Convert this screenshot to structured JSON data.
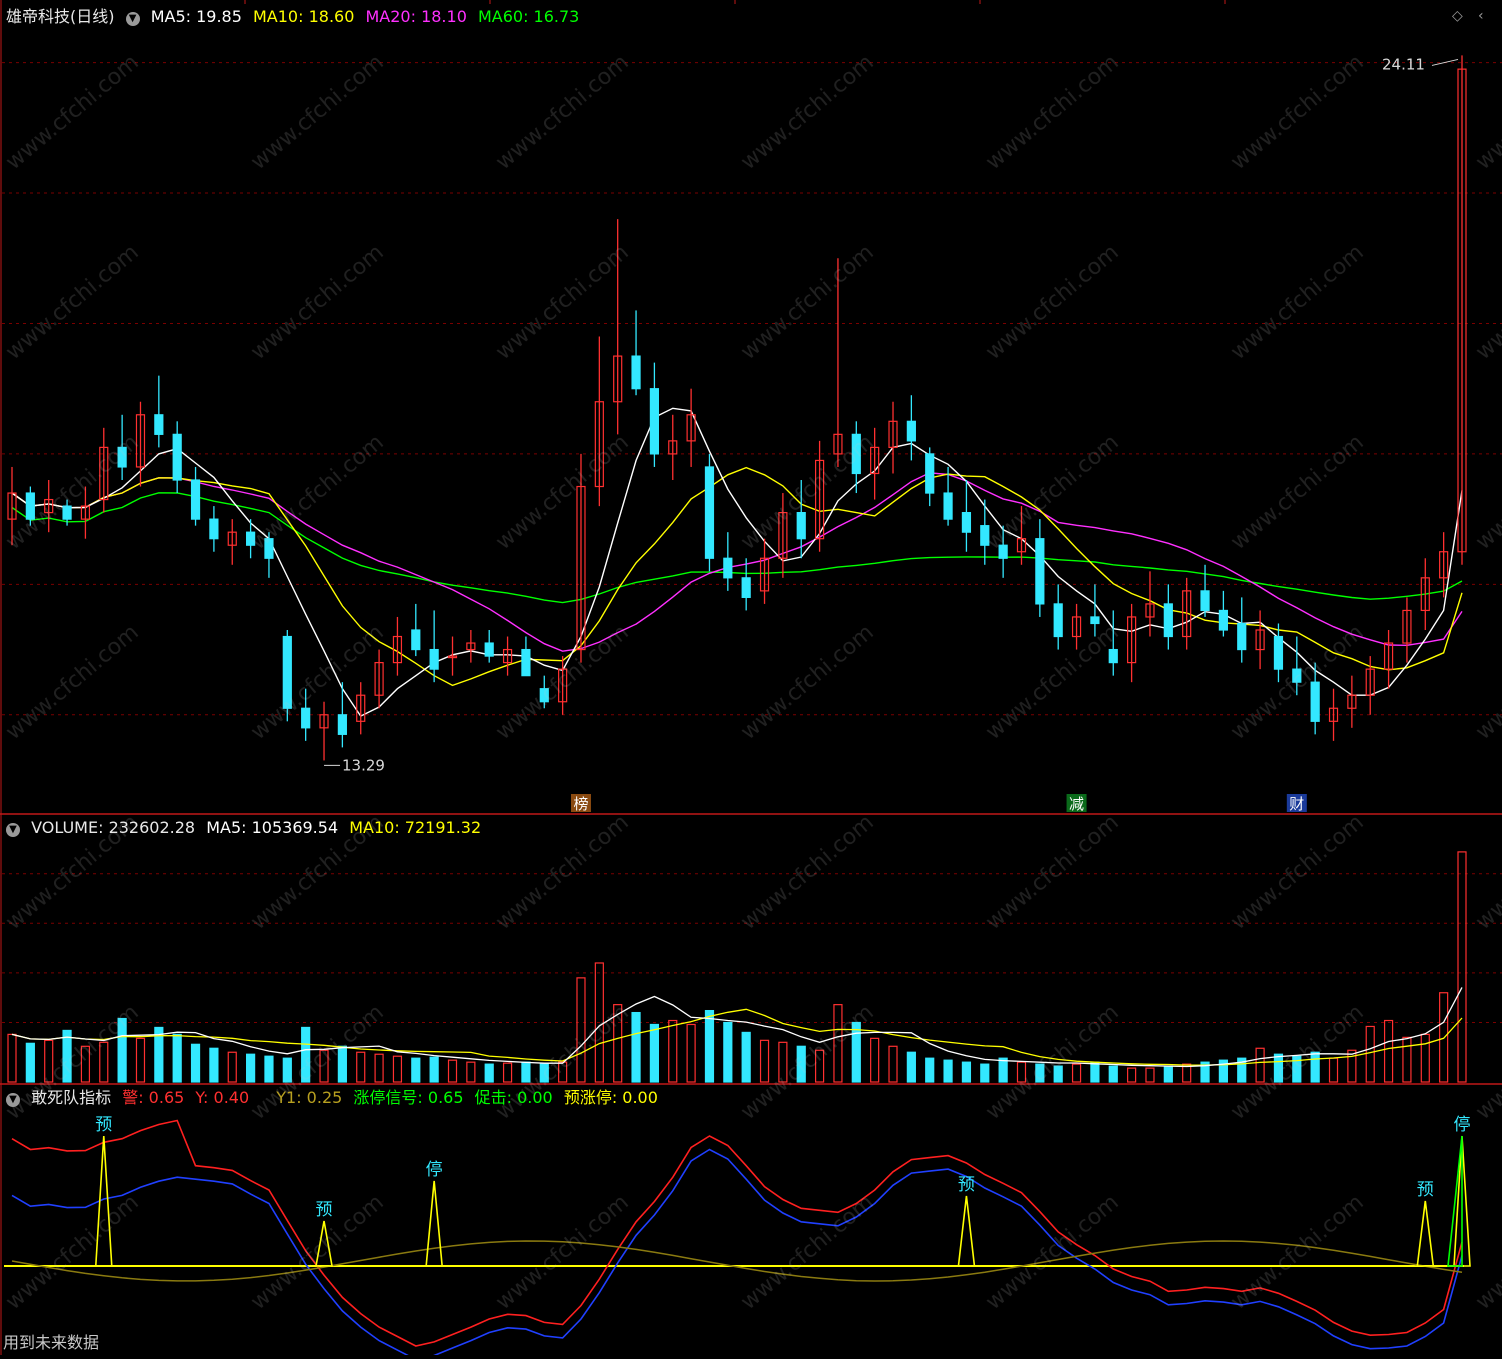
{
  "header": {
    "stock": "雄帝科技(日线)",
    "ma5": "MA5: 19.85",
    "ma10": "MA10: 18.60",
    "ma20": "MA20: 18.10",
    "ma60": "MA60: 16.73"
  },
  "volume_header": {
    "volume": "VOLUME: 232602.28",
    "ma5": "MA5: 105369.54",
    "ma10": "MA10: 72191.32"
  },
  "indicator_header": {
    "name": "敢死队指标",
    "jing": "警: 0.65",
    "y": "Y: 0.40",
    "y1": "Y1: 0.25",
    "zt_signal": "涨停信号: 0.65",
    "cuji": "促击: 0.00",
    "yu_zt": "预涨停: 0.00"
  },
  "footer_note": "用到未来数据",
  "watermark": "www.cfchi.com",
  "colors": {
    "bg": "#000000",
    "grid": "#7a0000",
    "up": "#ff3030",
    "down": "#33e8ff",
    "ma5": "#ffffff",
    "ma10": "#ffff00",
    "ma20": "#ff30ff",
    "ma60": "#00ff00",
    "signal": "#ffff00"
  },
  "chart_data": [
    {
      "type": "candlestick",
      "title": "雄帝科技(日线)",
      "bars": 80,
      "ohlc": [
        [
          17.0,
          17.8,
          16.6,
          17.4
        ],
        [
          17.4,
          17.5,
          16.9,
          17.0
        ],
        [
          17.1,
          17.6,
          16.8,
          17.3
        ],
        [
          17.2,
          17.3,
          16.9,
          17.0
        ],
        [
          17.0,
          17.5,
          16.7,
          17.2
        ],
        [
          17.3,
          18.4,
          17.1,
          18.1
        ],
        [
          18.1,
          18.6,
          17.6,
          17.8
        ],
        [
          17.8,
          18.8,
          17.5,
          18.6
        ],
        [
          18.6,
          19.2,
          18.1,
          18.3
        ],
        [
          18.3,
          18.5,
          17.4,
          17.6
        ],
        [
          17.6,
          17.8,
          16.9,
          17.0
        ],
        [
          17.0,
          17.2,
          16.5,
          16.7
        ],
        [
          16.6,
          17.0,
          16.3,
          16.8
        ],
        [
          16.8,
          17.0,
          16.4,
          16.6
        ],
        [
          16.7,
          16.8,
          16.1,
          16.4
        ],
        [
          15.2,
          15.3,
          13.9,
          14.1
        ],
        [
          14.1,
          14.4,
          13.6,
          13.8
        ],
        [
          13.8,
          14.2,
          13.3,
          14.0
        ],
        [
          14.0,
          14.5,
          13.5,
          13.7
        ],
        [
          13.9,
          14.5,
          13.7,
          14.3
        ],
        [
          14.3,
          15.0,
          14.1,
          14.8
        ],
        [
          14.8,
          15.5,
          14.6,
          15.2
        ],
        [
          15.3,
          15.7,
          14.9,
          15.0
        ],
        [
          15.0,
          15.6,
          14.5,
          14.7
        ],
        [
          14.9,
          15.2,
          14.6,
          14.9
        ],
        [
          15.0,
          15.3,
          14.8,
          15.1
        ],
        [
          15.1,
          15.3,
          14.8,
          14.9
        ],
        [
          14.8,
          15.2,
          14.6,
          15.0
        ],
        [
          15.0,
          15.2,
          14.6,
          14.6
        ],
        [
          14.4,
          14.6,
          14.1,
          14.2
        ],
        [
          14.2,
          14.9,
          14.0,
          14.7
        ],
        [
          15.0,
          18.0,
          14.8,
          17.5
        ],
        [
          17.5,
          19.8,
          17.2,
          18.8
        ],
        [
          18.8,
          21.6,
          18.3,
          19.5
        ],
        [
          19.5,
          20.2,
          18.9,
          19.0
        ],
        [
          19.0,
          19.4,
          17.8,
          18.0
        ],
        [
          18.0,
          18.6,
          17.6,
          18.2
        ],
        [
          18.2,
          19.0,
          17.8,
          18.6
        ],
        [
          17.8,
          18.0,
          16.2,
          16.4
        ],
        [
          16.4,
          16.8,
          15.9,
          16.1
        ],
        [
          16.1,
          16.4,
          15.6,
          15.8
        ],
        [
          15.9,
          16.7,
          15.7,
          16.4
        ],
        [
          16.4,
          17.4,
          16.1,
          17.1
        ],
        [
          17.1,
          17.6,
          16.4,
          16.7
        ],
        [
          16.7,
          18.2,
          16.5,
          17.9
        ],
        [
          18.0,
          21.0,
          17.8,
          18.3
        ],
        [
          18.3,
          18.5,
          17.4,
          17.7
        ],
        [
          17.7,
          18.4,
          17.3,
          18.1
        ],
        [
          18.1,
          18.8,
          17.7,
          18.5
        ],
        [
          18.5,
          18.9,
          17.9,
          18.2
        ],
        [
          18.0,
          18.1,
          17.2,
          17.4
        ],
        [
          17.4,
          17.8,
          16.9,
          17.0
        ],
        [
          17.1,
          17.6,
          16.5,
          16.8
        ],
        [
          16.9,
          17.3,
          16.3,
          16.6
        ],
        [
          16.6,
          16.9,
          16.1,
          16.4
        ],
        [
          16.5,
          17.2,
          16.3,
          16.7
        ],
        [
          16.7,
          17.0,
          15.5,
          15.7
        ],
        [
          15.7,
          16.0,
          15.0,
          15.2
        ],
        [
          15.2,
          15.7,
          15.0,
          15.5
        ],
        [
          15.5,
          16.0,
          15.2,
          15.4
        ],
        [
          15.0,
          15.6,
          14.6,
          14.8
        ],
        [
          14.8,
          15.7,
          14.5,
          15.5
        ],
        [
          15.5,
          16.2,
          15.2,
          15.7
        ],
        [
          15.7,
          16.0,
          15.0,
          15.2
        ],
        [
          15.2,
          16.1,
          15.0,
          15.9
        ],
        [
          15.9,
          16.3,
          15.5,
          15.6
        ],
        [
          15.6,
          15.9,
          15.2,
          15.3
        ],
        [
          15.4,
          15.8,
          14.8,
          15.0
        ],
        [
          15.0,
          15.6,
          14.7,
          15.3
        ],
        [
          15.2,
          15.4,
          14.5,
          14.7
        ],
        [
          14.7,
          15.2,
          14.3,
          14.5
        ],
        [
          14.5,
          14.8,
          13.7,
          13.9
        ],
        [
          13.9,
          14.4,
          13.6,
          14.1
        ],
        [
          14.1,
          14.6,
          13.8,
          14.3
        ],
        [
          14.3,
          14.9,
          14.0,
          14.7
        ],
        [
          14.7,
          15.3,
          14.4,
          15.1
        ],
        [
          15.1,
          15.8,
          14.8,
          15.6
        ],
        [
          15.6,
          16.4,
          15.3,
          16.1
        ],
        [
          16.1,
          16.8,
          15.8,
          16.5
        ],
        [
          16.5,
          24.11,
          16.3,
          23.9
        ]
      ],
      "annotations": [
        {
          "text": "24.11"
        },
        {
          "text": "13.29"
        },
        {
          "text": "榜"
        },
        {
          "text": "财"
        },
        {
          "text": "减"
        }
      ]
    },
    {
      "type": "bar",
      "title": "VOLUME",
      "values": [
        48,
        39,
        42,
        52,
        36,
        40,
        64,
        44,
        55,
        48,
        38,
        34,
        30,
        28,
        26,
        24,
        55,
        32,
        36,
        30,
        28,
        26,
        24,
        25,
        22,
        20,
        18,
        19,
        20,
        18,
        20,
        105,
        120,
        78,
        70,
        58,
        62,
        58,
        72,
        60,
        50,
        42,
        40,
        36,
        32,
        78,
        60,
        44,
        36,
        30,
        24,
        22,
        20,
        18,
        24,
        20,
        18,
        16,
        18,
        20,
        16,
        14,
        14,
        16,
        18,
        20,
        22,
        24,
        34,
        28,
        26,
        30,
        24,
        32,
        56,
        62,
        45,
        48,
        90,
        232
      ]
    },
    {
      "type": "line",
      "title": "敢死队指标",
      "series": [
        {
          "name": "警",
          "values": [
            0.65
          ]
        },
        {
          "name": "Y",
          "values": [
            0.4
          ]
        },
        {
          "name": "Y1",
          "values": [
            0.25
          ]
        },
        {
          "name": "涨停信号",
          "values": [
            0.65
          ]
        },
        {
          "name": "促击",
          "values": [
            0.0
          ]
        },
        {
          "name": "预涨停",
          "values": [
            0.0
          ]
        }
      ],
      "signals": [
        {
          "text": "预"
        },
        {
          "text": "预"
        },
        {
          "text": "停"
        },
        {
          "text": "预"
        },
        {
          "text": "预"
        },
        {
          "text": "停"
        }
      ]
    }
  ]
}
